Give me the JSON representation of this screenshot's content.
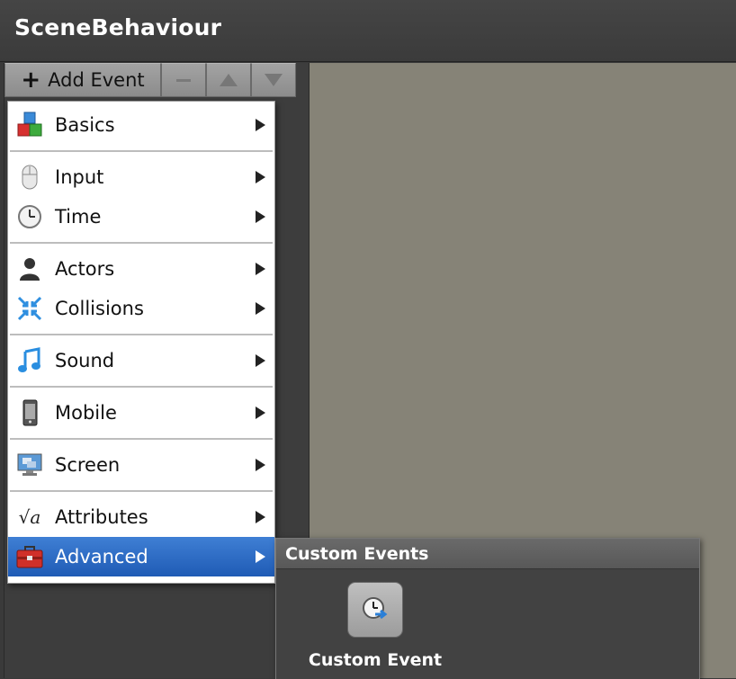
{
  "window": {
    "title": "SceneBehaviour"
  },
  "toolbar": {
    "add_event_label": "Add Event",
    "add_icon": "plus-icon",
    "remove_icon": "minus-icon",
    "move_up_icon": "arrow-up-icon",
    "move_down_icon": "arrow-down-icon"
  },
  "menu": {
    "items": [
      {
        "label": "Basics",
        "icon": "blocks-icon"
      },
      {
        "label": "Input",
        "icon": "mouse-icon"
      },
      {
        "label": "Time",
        "icon": "clock-icon"
      },
      {
        "label": "Actors",
        "icon": "person-icon"
      },
      {
        "label": "Collisions",
        "icon": "collision-arrows-icon"
      },
      {
        "label": "Sound",
        "icon": "music-note-icon"
      },
      {
        "label": "Mobile",
        "icon": "phone-icon"
      },
      {
        "label": "Screen",
        "icon": "monitor-icon"
      },
      {
        "label": "Attributes",
        "icon": "sqrt-a-icon"
      },
      {
        "label": "Advanced",
        "icon": "toolbox-icon",
        "selected": true
      }
    ]
  },
  "submenu": {
    "title": "Custom Events",
    "items": [
      {
        "label": "Custom Event",
        "icon": "clock-arrow-icon"
      }
    ]
  },
  "colors": {
    "selection": "#2a6bc8",
    "canvas": "#868377",
    "panel": "#3d3d3d"
  }
}
